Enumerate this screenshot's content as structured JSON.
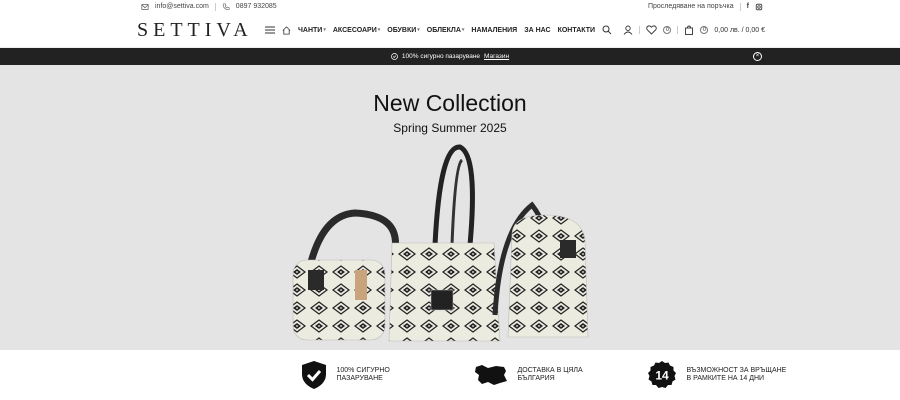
{
  "topbar": {
    "email": "info@settiva.com",
    "phone": "0897 932085",
    "track_order": "Проследяване на поръчка",
    "facebook_label": "f"
  },
  "header": {
    "logo": "SETTIVA",
    "nav": [
      {
        "label": "ЧАНТИ",
        "dropdown": true
      },
      {
        "label": "АКСЕСОАРИ",
        "dropdown": true
      },
      {
        "label": "ОБУВКИ",
        "dropdown": true
      },
      {
        "label": "ОБЛЕКЛА",
        "dropdown": true
      },
      {
        "label": "НАМАЛЕНИЯ",
        "dropdown": false
      },
      {
        "label": "ЗА НАС",
        "dropdown": false
      },
      {
        "label": "КОНТАКТИ",
        "dropdown": false
      }
    ],
    "wishlist_count": "0",
    "cart_count": "0",
    "cart_total": "0,00 лв. / 0,00 €"
  },
  "notice": {
    "text": "100% сигурно пазаруване",
    "link": "Магазин"
  },
  "hero": {
    "title": "New Collection",
    "subtitle": "Spring Summer 2025"
  },
  "features": [
    {
      "line1": "100% СИГУРНО",
      "line2": "ПАЗАРУВАНЕ",
      "icon": "shield-check-icon"
    },
    {
      "line1": "ДОСТАВКА В ЦЯЛА",
      "line2": "БЪЛГАРИЯ",
      "icon": "bulgaria-map-icon"
    },
    {
      "line1": "ВЪЗМОЖНОСТ ЗА ВРЪЩАНЕ",
      "line2": "В РАМКИТЕ НА 14 ДНИ",
      "icon": "fourteen-days-icon",
      "badge": "14"
    }
  ],
  "colors": {
    "accent": "#222222",
    "hero_bg": "#e4e4e4",
    "bag_cream": "#ecebe0"
  }
}
